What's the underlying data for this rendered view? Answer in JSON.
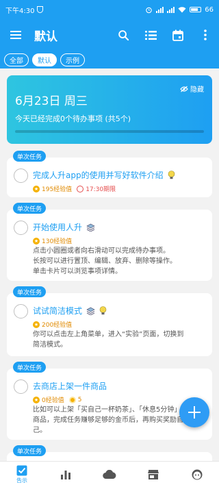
{
  "status_bar": {
    "time": "下午4:30",
    "battery": "66"
  },
  "app_bar": {
    "title": "默认"
  },
  "filters": [
    {
      "label": "全部",
      "active": false
    },
    {
      "label": "默认",
      "active": true
    },
    {
      "label": "示例",
      "active": false
    }
  ],
  "summary": {
    "date": "6月23日 周三",
    "hide_label": "隐藏",
    "note": "今天已经完成0个待办事项 (共5个)",
    "progress": 0
  },
  "tasks": [
    {
      "tag": "单次任务",
      "title": "完成人升app的使用并写好软件介绍",
      "xp": "195经验值",
      "due": "17:30期限"
    },
    {
      "tag": "单次任务",
      "title": "开始使用人升",
      "xp": "130经验值",
      "desc": [
        "点击小圆圈或者向右滑动可以完成待办事项。",
        "长按可以进行置顶、编辑、放弃、删除等操作。",
        "单击卡片可以浏览事项详情。"
      ]
    },
    {
      "tag": "单次任务",
      "title": "试试简洁模式",
      "xp": "200经验值",
      "desc": [
        "你可以点击左上角菜单，进入“实验”页面，切换到",
        "简洁模式。"
      ]
    },
    {
      "tag": "单次任务",
      "title": "去商店上架一件商品",
      "xp": "0经验值",
      "coins": "5",
      "desc": [
        "比如可以上架「买自己一杯奶茶」、「休息5分钟」",
        "商品，完成任务赚够足够的金币后，再购买奖励自",
        "己。"
      ]
    },
    {
      "tag": "单次任务"
    }
  ],
  "bottom_nav": [
    {
      "icon": "checkbox-icon",
      "label": "告示"
    },
    {
      "icon": "bar-chart-icon"
    },
    {
      "icon": "cloud-icon"
    },
    {
      "icon": "store-icon"
    },
    {
      "icon": "face-icon"
    }
  ]
}
